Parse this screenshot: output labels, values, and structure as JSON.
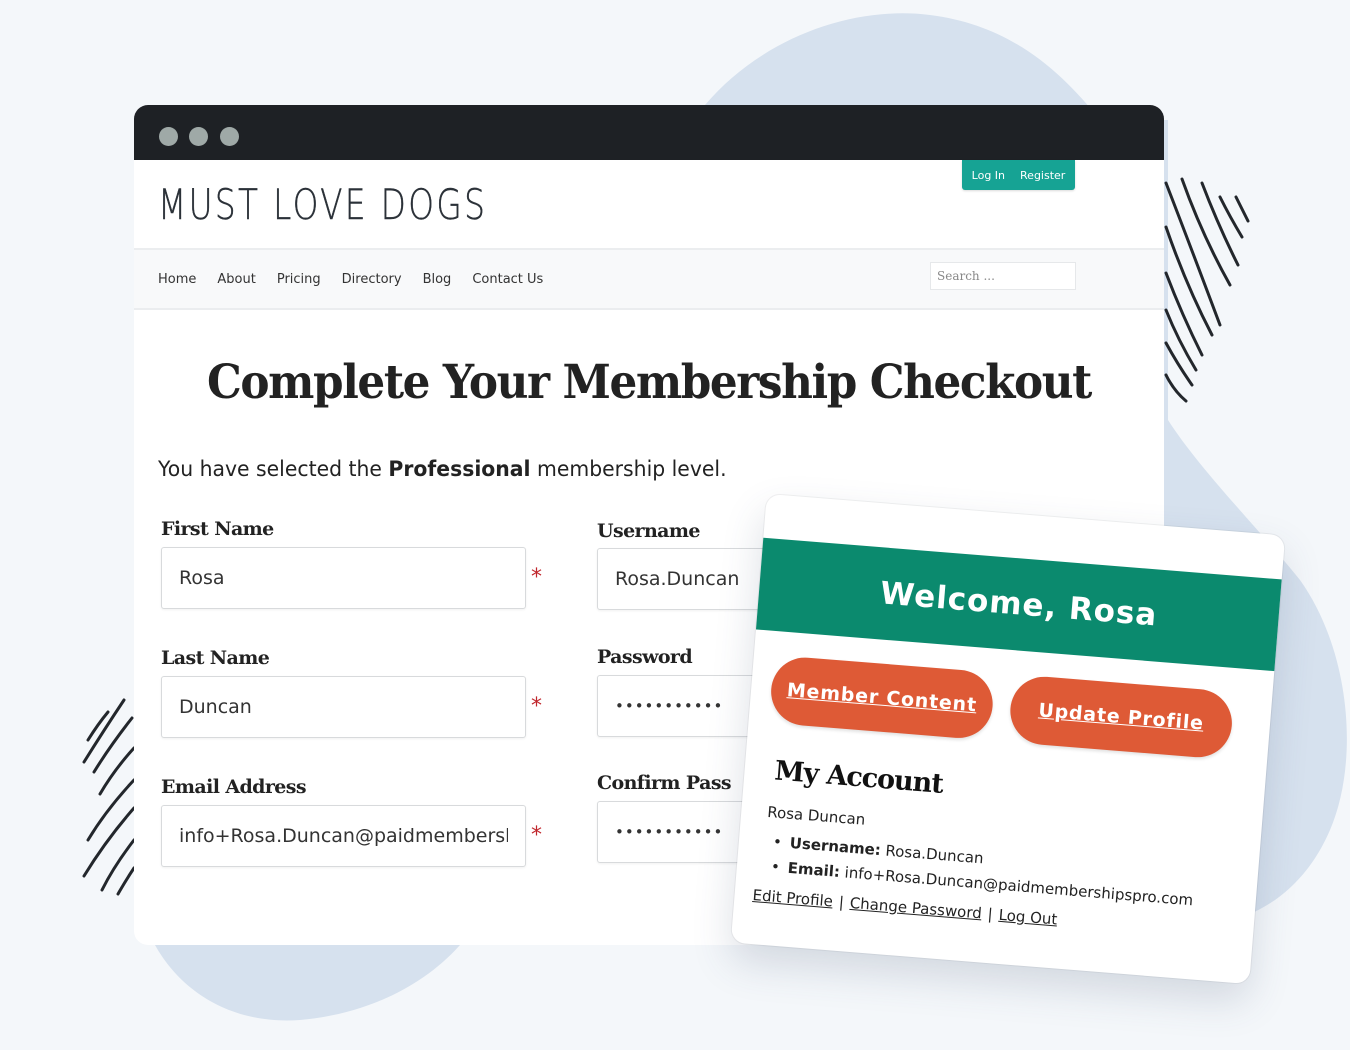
{
  "colors": {
    "background": "#f4f7fa",
    "blob": "#d6e1ee",
    "titlebar": "#1e2125",
    "window_dot": "#9fa9a7",
    "account_tab": "#16a394",
    "welcome_banner": "#0b8a6e",
    "pill_button": "#de5a36",
    "required": "#c0272d"
  },
  "browser": {
    "window_controls": [
      "dot",
      "dot",
      "dot"
    ]
  },
  "site": {
    "logo": "MUST LOVE DOGS",
    "account_links": {
      "login": "Log In",
      "register": "Register"
    },
    "nav": [
      "Home",
      "About",
      "Pricing",
      "Directory",
      "Blog",
      "Contact Us"
    ],
    "search": {
      "placeholder": "Search ...",
      "value": ""
    }
  },
  "checkout": {
    "title": "Complete Your Membership Checkout",
    "level_prefix": "You have selected the ",
    "level_name": "Professional",
    "level_suffix": " membership level.",
    "required_marker": "*",
    "fields": {
      "first_name": {
        "label": "First Name",
        "value": "Rosa"
      },
      "last_name": {
        "label": "Last Name",
        "value": "Duncan"
      },
      "email": {
        "label": "Email Address",
        "value": "info+Rosa.Duncan@paidmembershipspro.com"
      },
      "username": {
        "label": "Username",
        "value": "Rosa.Duncan"
      },
      "password": {
        "label": "Password",
        "value": "•••••••••••"
      },
      "confirm_password": {
        "label": "Confirm Pass",
        "value": "•••••••••••"
      }
    }
  },
  "welcome_card": {
    "banner": "Welcome, Rosa",
    "buttons": {
      "member_content": "Member Content",
      "update_profile": "Update Profile"
    },
    "account": {
      "title": "My Account",
      "name": "Rosa Duncan",
      "username_label": "Username:",
      "username_value": " Rosa.Duncan",
      "email_label": "Email:",
      "email_value": " info+Rosa.Duncan@paidmembershipspro.com",
      "links": {
        "edit_profile": "Edit Profile",
        "change_password": "Change Password",
        "log_out": "Log Out",
        "separator": "|"
      }
    }
  }
}
